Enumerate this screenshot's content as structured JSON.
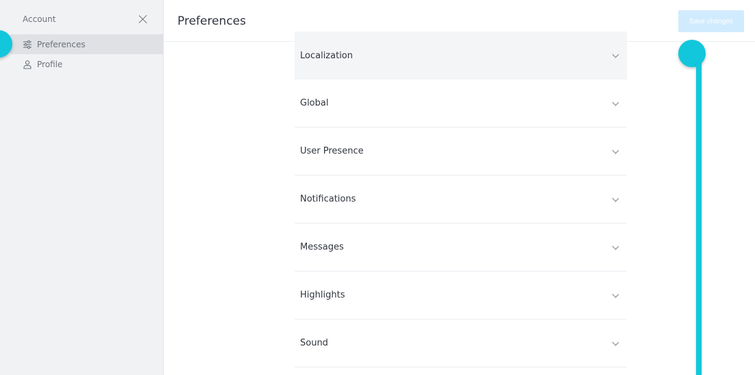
{
  "sidebar": {
    "title": "Account",
    "close_icon": "close-icon",
    "items": [
      {
        "label": "Preferences",
        "icon": "sliders-icon",
        "active": true
      },
      {
        "label": "Profile",
        "icon": "user-icon",
        "active": false
      }
    ]
  },
  "header": {
    "title": "Preferences",
    "save_label": "Save changes"
  },
  "sections": [
    {
      "label": "Localization"
    },
    {
      "label": "Global"
    },
    {
      "label": "User Presence"
    },
    {
      "label": "Notifications"
    },
    {
      "label": "Messages"
    },
    {
      "label": "Highlights"
    },
    {
      "label": "Sound"
    }
  ],
  "colors": {
    "accent": "#12c7dc",
    "save_button_bg": "#d1ebfe",
    "sidebar_bg": "#f1f2f4",
    "active_item_bg": "#dfe1e5"
  }
}
